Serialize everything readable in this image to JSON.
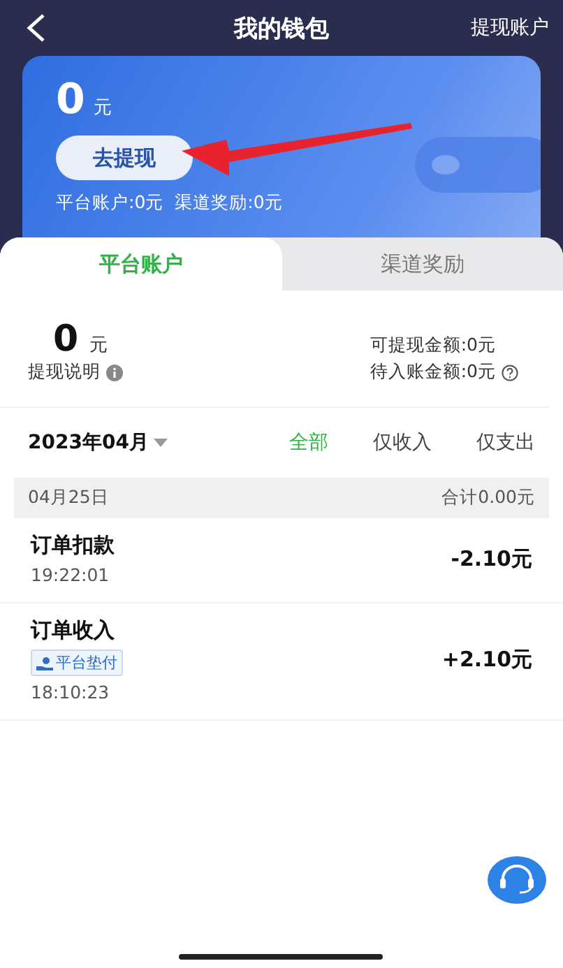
{
  "header": {
    "title": "我的钱包",
    "action": "提现账户"
  },
  "wallet_card": {
    "amount": "0",
    "unit": "元",
    "withdraw_button": "去提现",
    "summary": "平台账户:0元  渠道奖励:0元"
  },
  "tabs": [
    {
      "label": "平台账户",
      "selected": true
    },
    {
      "label": "渠道奖励",
      "selected": false
    }
  ],
  "balance": {
    "amount": "0",
    "unit": "元",
    "note": "提现说明",
    "withdrawable": "可提现金额:0元",
    "pending": "待入账金额:0元"
  },
  "filter": {
    "month": "2023年04月",
    "options": [
      {
        "label": "全部",
        "selected": true
      },
      {
        "label": "仅收入",
        "selected": false
      },
      {
        "label": "仅支出",
        "selected": false
      }
    ]
  },
  "day": {
    "date": "04月25日",
    "total": "合计0.00元"
  },
  "transactions": [
    {
      "title": "订单扣款",
      "time": "19:22:01",
      "amount": "-2.10元"
    },
    {
      "title": "订单收入",
      "tag": "平台垫付",
      "time": "18:10:23",
      "amount": "+2.10元"
    }
  ]
}
